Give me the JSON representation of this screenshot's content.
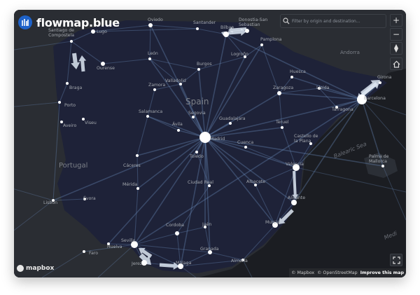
{
  "app": {
    "name": "flowmap.blue"
  },
  "search": {
    "placeholder": "Filter by origin and destination..."
  },
  "controls": {
    "zoom_in": "+",
    "zoom_out": "−",
    "compass": "⇧",
    "home": "⌂"
  },
  "attribution": {
    "mapbox": "© Mapbox",
    "osm": "© OpenStreetMap",
    "improve": "Improve this map"
  },
  "brand": {
    "mapbox": "mapbox"
  },
  "colors": {
    "flow": "#6e8fc0",
    "node": "#ffffff",
    "land": "#2a2d33",
    "region": "#1e2238",
    "sea": "#1b1d22",
    "label": "#a4a8ae"
  },
  "country_labels": [
    "Spain",
    "Portugal",
    "Andorra"
  ],
  "sea_labels": [
    "Balearic Sea",
    "Medi"
  ],
  "cities": [
    {
      "name": "Santiago de Compostela",
      "label_lines": [
        "Santiago de",
        "Compostela"
      ]
    },
    {
      "name": "Lugo"
    },
    {
      "name": "Oviedo"
    },
    {
      "name": "Santander"
    },
    {
      "name": "Bilbao"
    },
    {
      "name": "Donostia-San Sebastian",
      "label_lines": [
        "Donostia-San",
        "Sebastian"
      ]
    },
    {
      "name": "Pamplona"
    },
    {
      "name": "Logroño"
    },
    {
      "name": "León"
    },
    {
      "name": "Ourense"
    },
    {
      "name": "Burgos"
    },
    {
      "name": "Huesca"
    },
    {
      "name": "Girona"
    },
    {
      "name": "Zaragoza"
    },
    {
      "name": "Lleida"
    },
    {
      "name": "Barcelona"
    },
    {
      "name": "Tarragona"
    },
    {
      "name": "Braga"
    },
    {
      "name": "Zamora"
    },
    {
      "name": "Valladolid"
    },
    {
      "name": "Porto"
    },
    {
      "name": "Salamanca"
    },
    {
      "name": "Aveiro"
    },
    {
      "name": "Viseu"
    },
    {
      "name": "Segovia"
    },
    {
      "name": "Ávila"
    },
    {
      "name": "Guadalajara"
    },
    {
      "name": "Madrid"
    },
    {
      "name": "Teruel"
    },
    {
      "name": "Castello de la Plana",
      "label_lines": [
        "Castello de",
        "la Plana"
      ]
    },
    {
      "name": "Cuenca"
    },
    {
      "name": "Toledo"
    },
    {
      "name": "Cáceres"
    },
    {
      "name": "Valencia"
    },
    {
      "name": "Palma de Mallorca",
      "label_lines": [
        "Palma de",
        "Mallorca"
      ]
    },
    {
      "name": "Ciudad Real"
    },
    {
      "name": "Albacete"
    },
    {
      "name": "Mérida"
    },
    {
      "name": "Évora"
    },
    {
      "name": "Lisbon"
    },
    {
      "name": "Alicante"
    },
    {
      "name": "Cordoba"
    },
    {
      "name": "Jaén"
    },
    {
      "name": "Murcia"
    },
    {
      "name": "Seville"
    },
    {
      "name": "Huelva"
    },
    {
      "name": "Granada"
    },
    {
      "name": "Almería"
    },
    {
      "name": "Faro"
    },
    {
      "name": "Málaga"
    },
    {
      "name": "Jerez"
    }
  ]
}
